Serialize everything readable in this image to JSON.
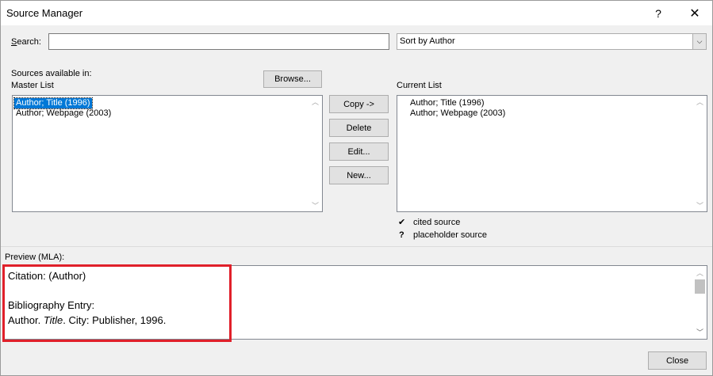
{
  "window": {
    "title": "Source Manager",
    "help": "?",
    "close_glyph": "✕"
  },
  "search": {
    "label": "Search:",
    "value": ""
  },
  "sort": {
    "selected": "Sort by Author",
    "arrow": "⌵"
  },
  "sources": {
    "label_line1": "Sources available in:",
    "label_line2": "Master List",
    "browse_label": "Browse..."
  },
  "master_list": {
    "items": [
      "Author; Title (1996)",
      "Author; Webpage (2003)"
    ]
  },
  "buttons": {
    "copy": "Copy ->",
    "delete": "Delete",
    "edit": "Edit...",
    "new": "New..."
  },
  "current_list": {
    "label": "Current List",
    "items": [
      "Author; Title (1996)",
      "Author; Webpage (2003)"
    ]
  },
  "legend": {
    "cited_symbol": "✔",
    "cited_label": "cited source",
    "placeholder_symbol": "?",
    "placeholder_label": "placeholder source"
  },
  "preview": {
    "label": "Preview (MLA):",
    "citation": "Citation:  (Author)",
    "bibliography_heading": "Bibliography Entry:",
    "entry_author": "Author. ",
    "entry_title": "Title",
    "entry_rest": ". City: Publisher, 1996."
  },
  "footer": {
    "close_label": "Close"
  },
  "colors": {
    "highlight": "#0078d7",
    "annotation": "#e0202a"
  }
}
